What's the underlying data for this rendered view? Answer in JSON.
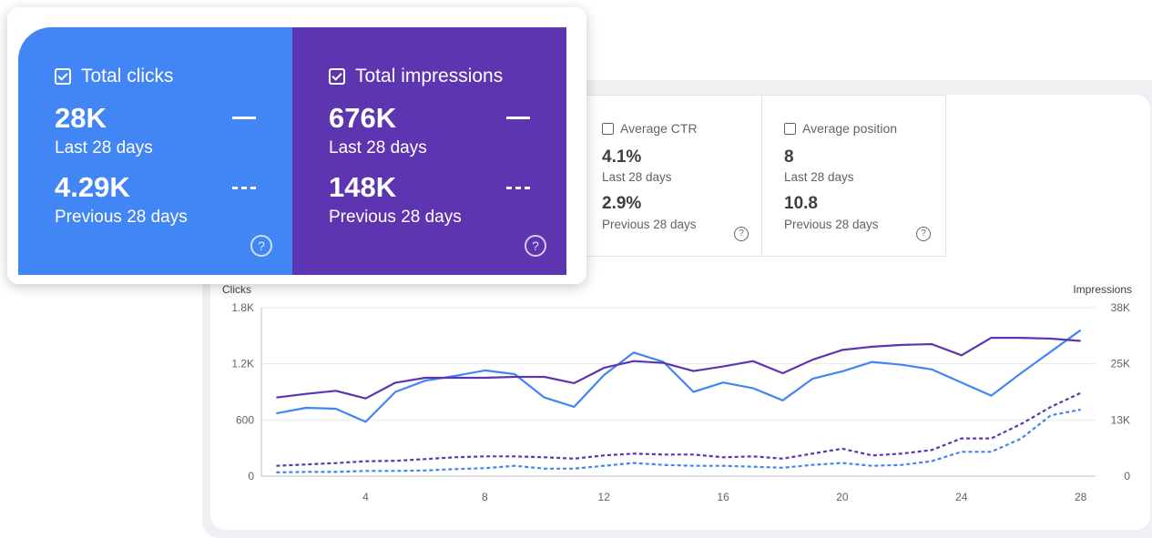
{
  "cards": {
    "clicks": {
      "label": "Total clicks",
      "value": "28K",
      "current_period": "Last 28 days",
      "prev_value": "4.29K",
      "prev_period": "Previous 28 days",
      "color": "#4285f4"
    },
    "impressions": {
      "label": "Total impressions",
      "value": "676K",
      "current_period": "Last 28 days",
      "prev_value": "148K",
      "prev_period": "Previous 28 days",
      "color": "#5e35b1"
    },
    "ctr": {
      "label": "Average CTR",
      "value": "4.1%",
      "current_period": "Last 28 days",
      "prev_value": "2.9%",
      "prev_period": "Previous 28 days"
    },
    "position": {
      "label": "Average position",
      "value": "8",
      "current_period": "Last 28 days",
      "prev_value": "10.8",
      "prev_period": "Previous 28 days"
    }
  },
  "help_glyph": "?",
  "chart_data": {
    "type": "line",
    "xlabel": "",
    "y_left_label": "Clicks",
    "y_right_label": "Impressions",
    "x": [
      1,
      2,
      3,
      4,
      5,
      6,
      7,
      8,
      9,
      10,
      11,
      12,
      13,
      14,
      15,
      16,
      17,
      18,
      19,
      20,
      21,
      22,
      23,
      24,
      25,
      26,
      27,
      28
    ],
    "x_ticks": [
      "4",
      "8",
      "12",
      "16",
      "20",
      "24",
      "28"
    ],
    "x_tick_values": [
      4,
      8,
      12,
      16,
      20,
      24,
      28
    ],
    "y_left_ticks": [
      "0",
      "600",
      "1.2K",
      "1.8K"
    ],
    "y_left_tick_values": [
      0,
      600,
      1200,
      1800
    ],
    "y_left_range": [
      0,
      1800
    ],
    "y_right_ticks": [
      "0",
      "13K",
      "25K",
      "38K"
    ],
    "y_right_tick_values": [
      0,
      12500,
      25000,
      37500
    ],
    "y_right_range": [
      0,
      37500
    ],
    "grid": true,
    "series": [
      {
        "name": "Total clicks",
        "axis": "left",
        "style": "solid",
        "color": "#4285f4",
        "values": [
          670,
          730,
          720,
          580,
          900,
          1020,
          1070,
          1130,
          1090,
          840,
          740,
          1080,
          1320,
          1220,
          900,
          1000,
          940,
          810,
          1040,
          1120,
          1220,
          1190,
          1140,
          1000,
          860,
          1100,
          1330,
          1560
        ]
      },
      {
        "name": "Total impressions",
        "axis": "right",
        "style": "solid",
        "color": "#5e35b1",
        "values": [
          17500,
          18300,
          19000,
          17300,
          20800,
          21900,
          21900,
          21900,
          22100,
          22100,
          20700,
          24100,
          25600,
          25200,
          23400,
          24400,
          25600,
          22900,
          25900,
          28100,
          28800,
          29200,
          29400,
          26900,
          30800,
          30800,
          30600,
          30100
        ]
      },
      {
        "name": "Total clicks (previous 28 days)",
        "axis": "left",
        "style": "dashed",
        "color": "#4285f4",
        "values": [
          40,
          45,
          45,
          55,
          55,
          60,
          75,
          85,
          110,
          80,
          80,
          110,
          140,
          120,
          110,
          110,
          100,
          90,
          120,
          140,
          110,
          120,
          160,
          260,
          260,
          400,
          650,
          710
        ]
      },
      {
        "name": "Total impressions (previous 28 days)",
        "axis": "right",
        "style": "dashed",
        "color": "#5e35b1",
        "values": [
          2300,
          2600,
          2900,
          3300,
          3400,
          3800,
          4200,
          4400,
          4400,
          4200,
          3900,
          4600,
          5000,
          4800,
          4800,
          4200,
          4400,
          3900,
          5000,
          6100,
          4600,
          5000,
          5800,
          8400,
          8400,
          11600,
          15400,
          18500
        ]
      }
    ]
  }
}
